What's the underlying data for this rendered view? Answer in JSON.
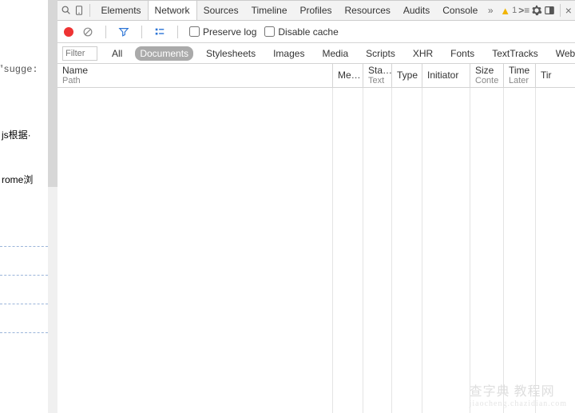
{
  "left": {
    "code_snippet": "=\"sugge:",
    "link1": "js根据·",
    "link2": "rome浏"
  },
  "tabbar": {
    "tabs": [
      "Elements",
      "Network",
      "Sources",
      "Timeline",
      "Profiles",
      "Resources",
      "Audits",
      "Console"
    ],
    "active_index": 1,
    "warn_count": "1",
    "overflow_glyph": "»"
  },
  "toolbar": {
    "preserve_log": "Preserve log",
    "disable_cache": "Disable cache"
  },
  "filterbar": {
    "placeholder": "Filter",
    "items": [
      "All",
      "Documents",
      "Stylesheets",
      "Images",
      "Media",
      "Scripts",
      "XHR",
      "Fonts",
      "TextTracks",
      "WebSockets"
    ],
    "active_index": 1
  },
  "columns": {
    "name": {
      "head": "Name",
      "sub": "Path"
    },
    "method": {
      "head": "Me…",
      "sub": ""
    },
    "status": {
      "head": "Sta…",
      "sub": "Text"
    },
    "type": {
      "head": "Type",
      "sub": ""
    },
    "init": {
      "head": "Initiator",
      "sub": ""
    },
    "size": {
      "head": "Size",
      "sub": "Conte"
    },
    "time": {
      "head": "Time",
      "sub": "Later"
    },
    "tl": {
      "head": "Tir",
      "sub": ""
    }
  },
  "watermark": {
    "main": "查字典 教程网",
    "sub": "jiaocheng.chazidian.com"
  }
}
